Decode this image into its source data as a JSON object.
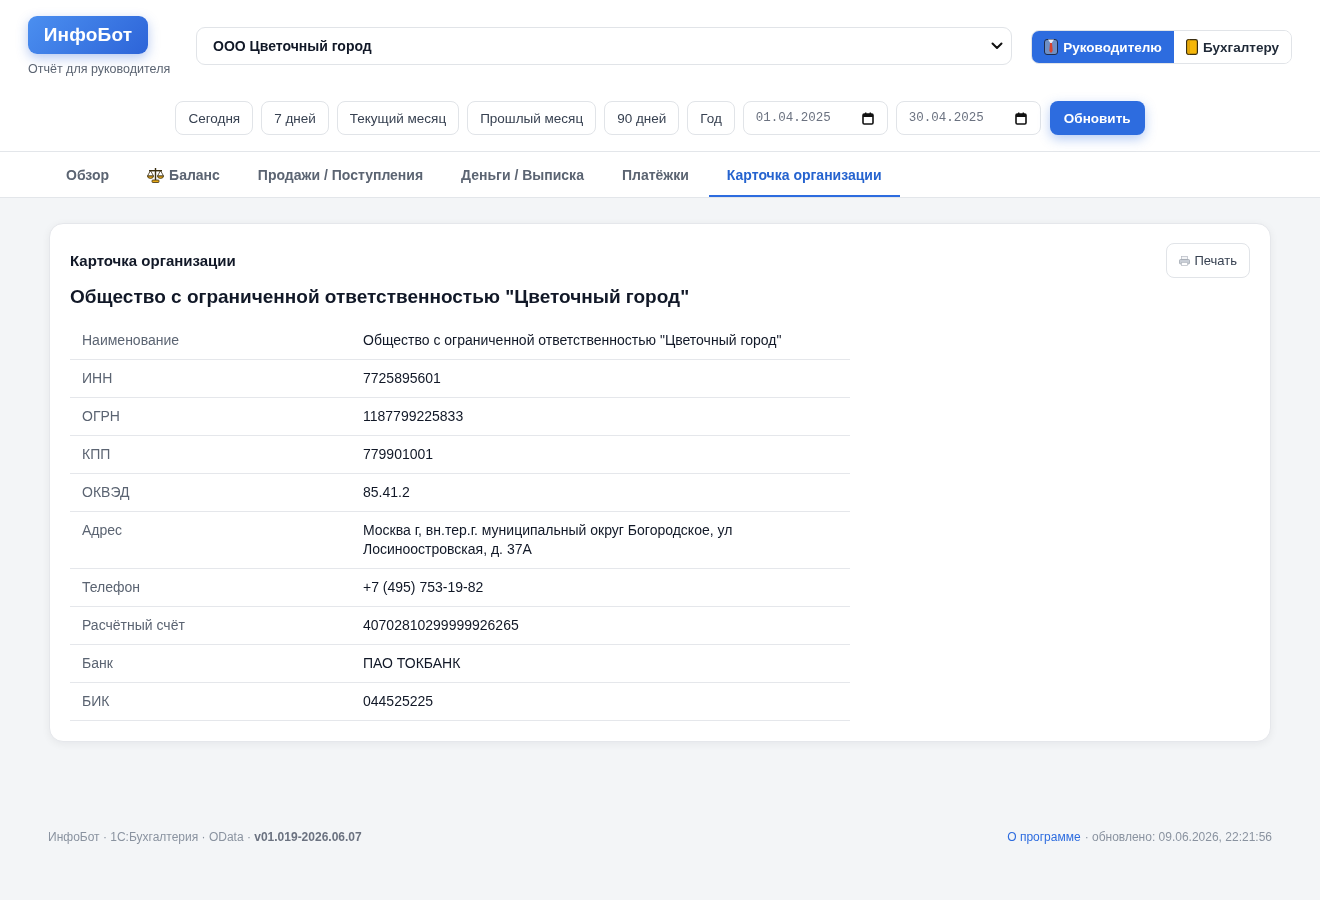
{
  "header": {
    "logo": "ИнфоБот",
    "subtitle": "Отчёт для руководителя",
    "organization_select": {
      "value": "ООО Цветочный город"
    },
    "roles": [
      {
        "label": "Руководителю",
        "selected": true
      },
      {
        "label": "Бухгалтеру",
        "selected": false
      }
    ]
  },
  "period": {
    "presets": [
      "Сегодня",
      "7 дней",
      "Текущий месяц",
      "Прошлый месяц",
      "90 дней",
      "Год"
    ],
    "date_from": {
      "value": "01.04.2025"
    },
    "date_to": {
      "value": "30.04.2025"
    },
    "refresh_button": "Обновить"
  },
  "tabs": [
    {
      "label": "Обзор",
      "kind": "text",
      "selected": false
    },
    {
      "label": "Баланс",
      "kind": "icon",
      "selected": false
    },
    {
      "label": "Продажи / Поступления",
      "kind": "text",
      "selected": false
    },
    {
      "label": "Деньги / Выписка",
      "kind": "text",
      "selected": false
    },
    {
      "label": "Платёжки",
      "kind": "text",
      "selected": false
    },
    {
      "label": "Карточка организации",
      "kind": "text",
      "selected": true
    }
  ],
  "card": {
    "title": "Карточка организации",
    "print_button": "Печать",
    "heading": "Общество с ограниченной ответственностью \"Цветочный город\"",
    "rows": [
      {
        "label": "Наименование",
        "value": "Общество с ограниченной ответственностью \"Цветочный город\""
      },
      {
        "label": "ИНН",
        "value": "7725895601"
      },
      {
        "label": "ОГРН",
        "value": "1187799225833"
      },
      {
        "label": "КПП",
        "value": "779901001"
      },
      {
        "label": "ОКВЭД",
        "value": "85.41.2"
      },
      {
        "label": "Адрес",
        "value": "Москва г, вн.тер.г. муниципальный округ Богородское, ул Лосиноостровская, д. 37А"
      },
      {
        "label": "Телефон",
        "value": "+7 (495) 753-19-82"
      },
      {
        "label": "Расчётный счёт",
        "value": "40702810299999926265"
      },
      {
        "label": "Банк",
        "value": "ПАО ТОКБАНК"
      },
      {
        "label": "БИК",
        "value": "044525225"
      }
    ]
  },
  "footer": {
    "info": "ИнфоБот · 1С:Бухгалтерия · OData · **v01.019-2026.06.07**",
    "about_link": "О программе",
    "updated": "· обновлено: 09.06.2026, 22:21:56"
  }
}
